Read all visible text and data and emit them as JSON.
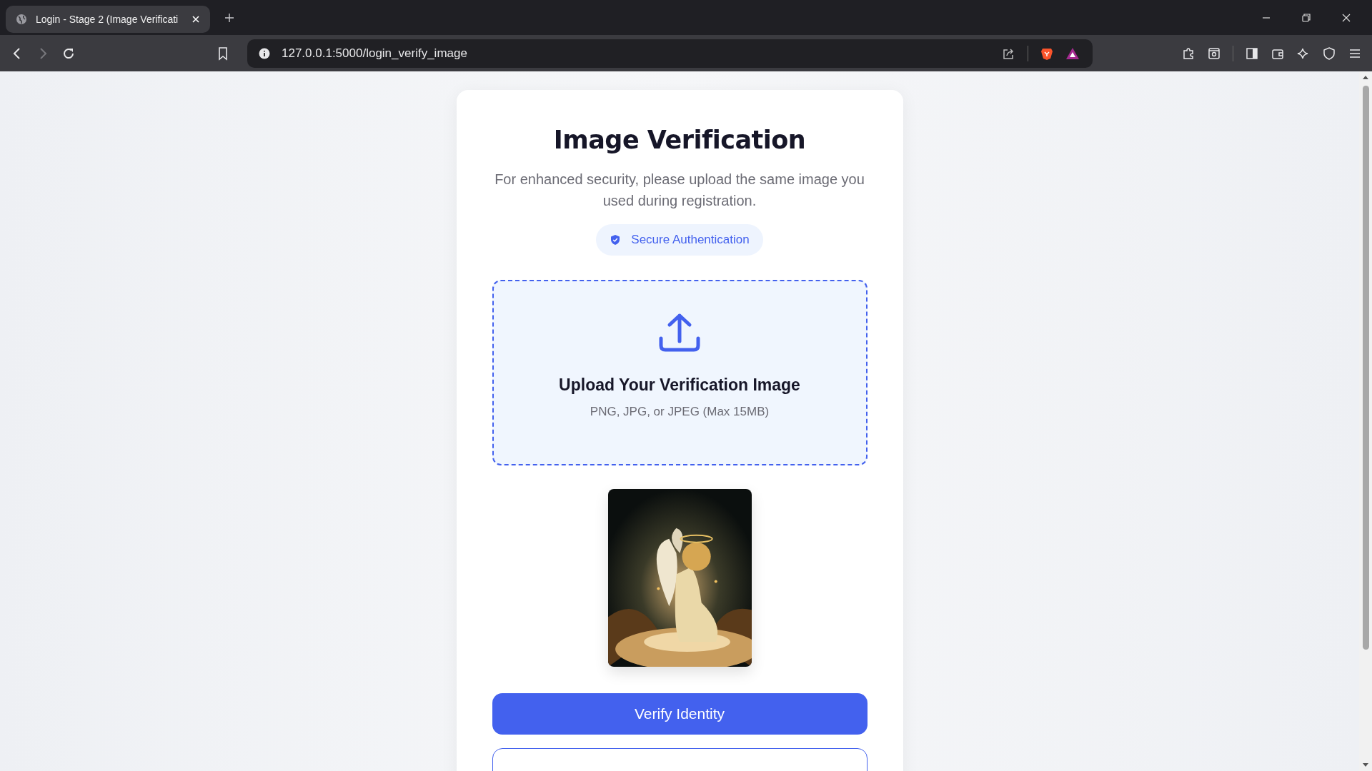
{
  "browser": {
    "tab_title": "Login - Stage 2 (Image Verificati",
    "url": "127.0.0.1:5000/login_verify_image"
  },
  "card": {
    "title": "Image Verification",
    "description": "For enhanced security, please upload the same image you used during registration.",
    "badge": "Secure Authentication",
    "upload": {
      "title": "Upload Your Verification Image",
      "hint": "PNG, JPG, or JPEG (Max 15MB)"
    },
    "buttons": [
      {
        "kind": "primary",
        "label": "Verify Identity"
      },
      {
        "kind": "outline"
      }
    ]
  }
}
